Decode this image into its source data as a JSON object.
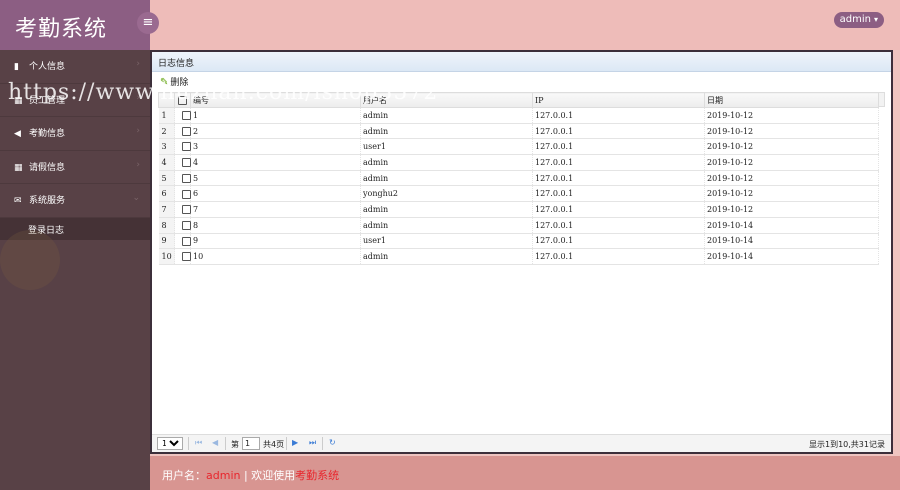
{
  "app": {
    "title": "考勤系统",
    "menu_toggle": "≡"
  },
  "header": {
    "user": "admin"
  },
  "sidebar": {
    "items": [
      {
        "label": "个人信息",
        "icon": "book-icon"
      },
      {
        "label": "员工管理",
        "icon": "grid-icon"
      },
      {
        "label": "考勤信息",
        "icon": "bullhorn-icon"
      },
      {
        "label": "请假信息",
        "icon": "grid-icon"
      },
      {
        "label": "系统服务",
        "icon": "envelope-icon"
      }
    ],
    "sub_items": [
      {
        "label": "登录日志"
      }
    ]
  },
  "watermark": "https://www.huzhan.com/ishop3572",
  "panel": {
    "title": "日志信息",
    "toolbar": {
      "delete_label": "删除"
    },
    "columns": [
      "编号",
      "用户名",
      "IP",
      "日期"
    ],
    "rows": [
      {
        "rn": "1",
        "id": "1",
        "user": "admin",
        "ip": "127.0.0.1",
        "date": "2019-10-12"
      },
      {
        "rn": "2",
        "id": "2",
        "user": "admin",
        "ip": "127.0.0.1",
        "date": "2019-10-12"
      },
      {
        "rn": "3",
        "id": "3",
        "user": "user1",
        "ip": "127.0.0.1",
        "date": "2019-10-12"
      },
      {
        "rn": "4",
        "id": "4",
        "user": "admin",
        "ip": "127.0.0.1",
        "date": "2019-10-12"
      },
      {
        "rn": "5",
        "id": "5",
        "user": "admin",
        "ip": "127.0.0.1",
        "date": "2019-10-12"
      },
      {
        "rn": "6",
        "id": "6",
        "user": "yonghu2",
        "ip": "127.0.0.1",
        "date": "2019-10-12"
      },
      {
        "rn": "7",
        "id": "7",
        "user": "admin",
        "ip": "127.0.0.1",
        "date": "2019-10-12"
      },
      {
        "rn": "8",
        "id": "8",
        "user": "admin",
        "ip": "127.0.0.1",
        "date": "2019-10-14"
      },
      {
        "rn": "9",
        "id": "9",
        "user": "user1",
        "ip": "127.0.0.1",
        "date": "2019-10-14"
      },
      {
        "rn": "10",
        "id": "10",
        "user": "admin",
        "ip": "127.0.0.1",
        "date": "2019-10-14"
      }
    ],
    "pager": {
      "page_size": "10",
      "page_prefix": "第",
      "page_value": "1",
      "page_suffix": "共4页",
      "info": "显示1到10,共31记录"
    }
  },
  "footer": {
    "user_label": "用户名：",
    "user": "admin",
    "separator": " | ",
    "welcome": "欢迎使用",
    "system": "考勤系统"
  },
  "colors": {
    "brand_bg": "#8c5e83",
    "sidebar_bg": "#584146",
    "header_bg": "#eebcb9",
    "footer_bg": "#d89591",
    "accent_red": "#e8262d",
    "pager_blue": "#3a7bd5"
  }
}
